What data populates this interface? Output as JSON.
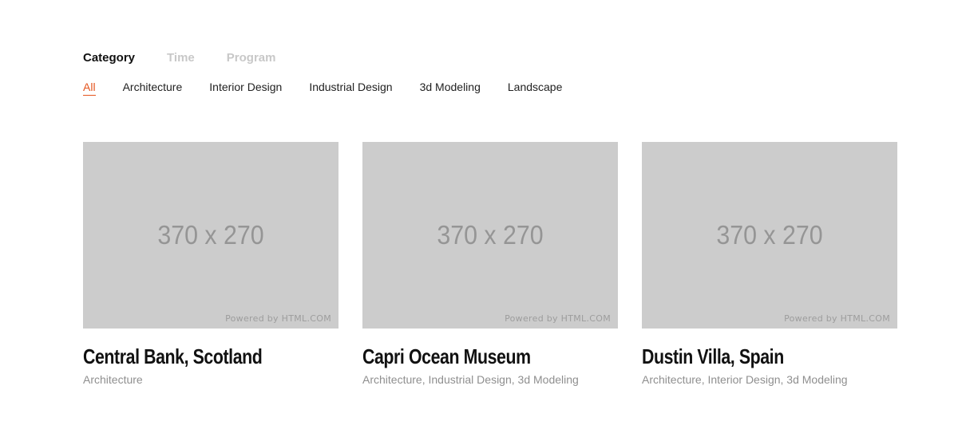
{
  "group_tabs": [
    {
      "label": "Category",
      "active": true
    },
    {
      "label": "Time",
      "active": false
    },
    {
      "label": "Program",
      "active": false
    }
  ],
  "filters": [
    {
      "label": "All",
      "active": true
    },
    {
      "label": "Architecture",
      "active": false
    },
    {
      "label": "Interior Design",
      "active": false
    },
    {
      "label": "Industrial Design",
      "active": false
    },
    {
      "label": "3d Modeling",
      "active": false
    },
    {
      "label": "Landscape",
      "active": false
    }
  ],
  "cards": [
    {
      "thumb_size": "370 x 270",
      "thumb_powered": "Powered by HTML.COM",
      "title": "Central Bank, Scotland",
      "tags": "Architecture"
    },
    {
      "thumb_size": "370 x 270",
      "thumb_powered": "Powered by HTML.COM",
      "title": "Capri Ocean Museum",
      "tags": "Architecture, Industrial Design, 3d Modeling"
    },
    {
      "thumb_size": "370 x 270",
      "thumb_powered": "Powered by HTML.COM",
      "title": "Dustin Villa, Spain",
      "tags": "Architecture, Interior Design, 3d Modeling"
    }
  ],
  "colors": {
    "accent": "#e4541e",
    "placeholder_bg": "#cccccc",
    "inactive_tab": "#c8c8c8",
    "tag_text": "#8f8f8f"
  }
}
